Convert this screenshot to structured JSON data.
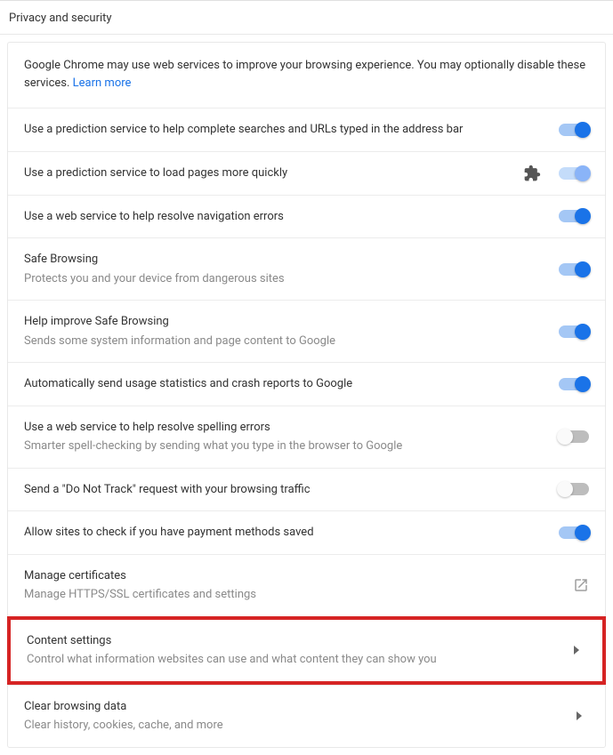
{
  "header": {
    "title": "Privacy and security"
  },
  "intro": {
    "text": "Google Chrome may use web services to improve your browsing experience. You may optionally disable these services.",
    "learn_more": "Learn more"
  },
  "rows": {
    "predict_addr": {
      "title": "Use a prediction service to help complete searches and URLs typed in the address bar"
    },
    "predict_pages": {
      "title": "Use a prediction service to load pages more quickly"
    },
    "nav_errors": {
      "title": "Use a web service to help resolve navigation errors"
    },
    "safe_browsing": {
      "title": "Safe Browsing",
      "sub": "Protects you and your device from dangerous sites"
    },
    "improve_sb": {
      "title": "Help improve Safe Browsing",
      "sub": "Sends some system information and page content to Google"
    },
    "stats": {
      "title": "Automatically send usage statistics and crash reports to Google"
    },
    "spelling": {
      "title": "Use a web service to help resolve spelling errors",
      "sub": "Smarter spell-checking by sending what you type in the browser to Google"
    },
    "dnt": {
      "title": "Send a \"Do Not Track\" request with your browsing traffic"
    },
    "payment": {
      "title": "Allow sites to check if you have payment methods saved"
    },
    "certs": {
      "title": "Manage certificates",
      "sub": "Manage HTTPS/SSL certificates and settings"
    },
    "content": {
      "title": "Content settings",
      "sub": "Control what information websites can use and what content they can show you"
    },
    "clear": {
      "title": "Clear browsing data",
      "sub": "Clear history, cookies, cache, and more"
    }
  }
}
